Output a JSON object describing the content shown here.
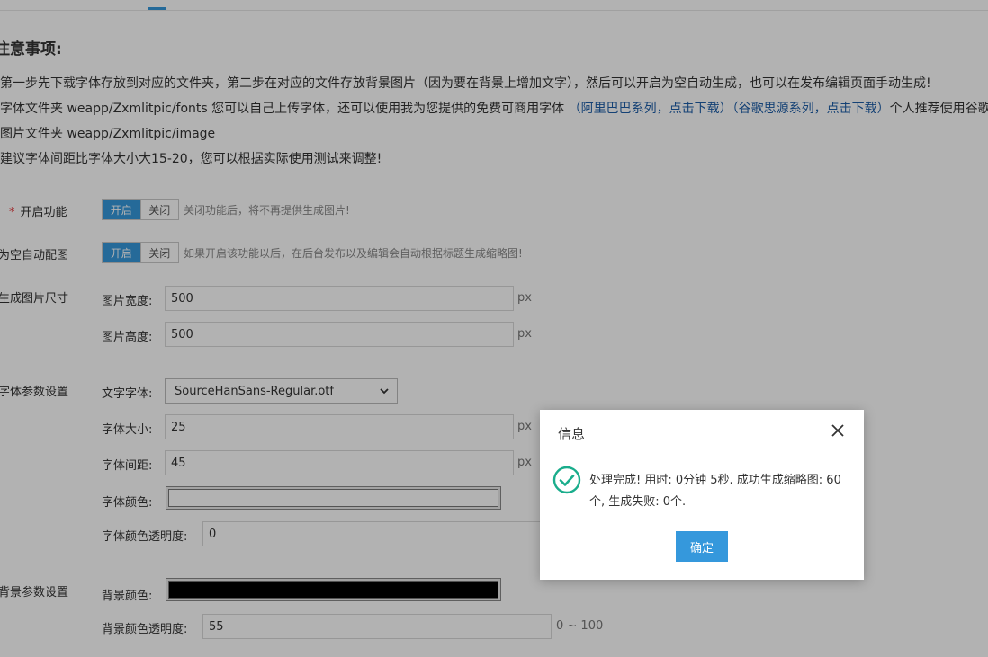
{
  "notice": {
    "title": "注意事项:",
    "line1": "第一步先下载字体存放到对应的文件夹，第二步在对应的文件存放背景图片（因为要在背景上增加文字），然后可以开启为空自动生成，也可以在发布编辑页面手动生成!",
    "line2_prefix": "字体文件夹 weapp/Zxmlitpic/fonts 您可以自己上传字体，还可以使用我为您提供的免费可商用字体 ",
    "link_alibaba": "（阿里巴巴系列，点击下载）",
    "link_google": "（谷歌思源系列，点击下载）",
    "line2_suffix": "个人推荐使用谷歌",
    "line3": "图片文件夹 weapp/Zxmlitpic/image",
    "line4": "建议字体间距比字体大小大15-20，您可以根据实际使用测试来调整!"
  },
  "enable": {
    "label": "开启功能",
    "required_mark": "*",
    "on_label": "开启",
    "off_label": "关闭",
    "hint": "关闭功能后，将不再提供生成图片!"
  },
  "auto_match": {
    "label": "为空自动配图",
    "on_label": "开启",
    "off_label": "关闭",
    "hint": "如果开启该功能以后，在后台发布以及编辑会自动根据标题生成缩略图!"
  },
  "size": {
    "label": "生成图片尺寸",
    "width_label": "图片宽度:",
    "width_value": "500",
    "height_label": "图片高度:",
    "height_value": "500",
    "unit": "px"
  },
  "font": {
    "label": "字体参数设置",
    "family_label": "文字字体:",
    "family_value": "SourceHanSans-Regular.otf",
    "size_label": "字体大小:",
    "size_value": "25",
    "spacing_label": "字体间距:",
    "spacing_value": "45",
    "color_label": "字体颜色:",
    "color_value": "#ffffff",
    "opacity_label": "字体颜色透明度:",
    "opacity_value": "0",
    "unit": "px"
  },
  "background": {
    "label": "背景参数设置",
    "color_label": "背景颜色:",
    "color_value": "#000000",
    "opacity_label": "背景颜色透明度:",
    "opacity_value": "55",
    "range": "0 ~ 100"
  },
  "dialog": {
    "title": "信息",
    "message": "处理完成! 用时: 0分钟 5秒. 成功生成缩略图: 60个, 生成失败: 0个.",
    "confirm": "确定",
    "success_color": "#1aad8c"
  },
  "colors": {
    "accent": "#3598dc",
    "link": "#1e5ea8"
  }
}
